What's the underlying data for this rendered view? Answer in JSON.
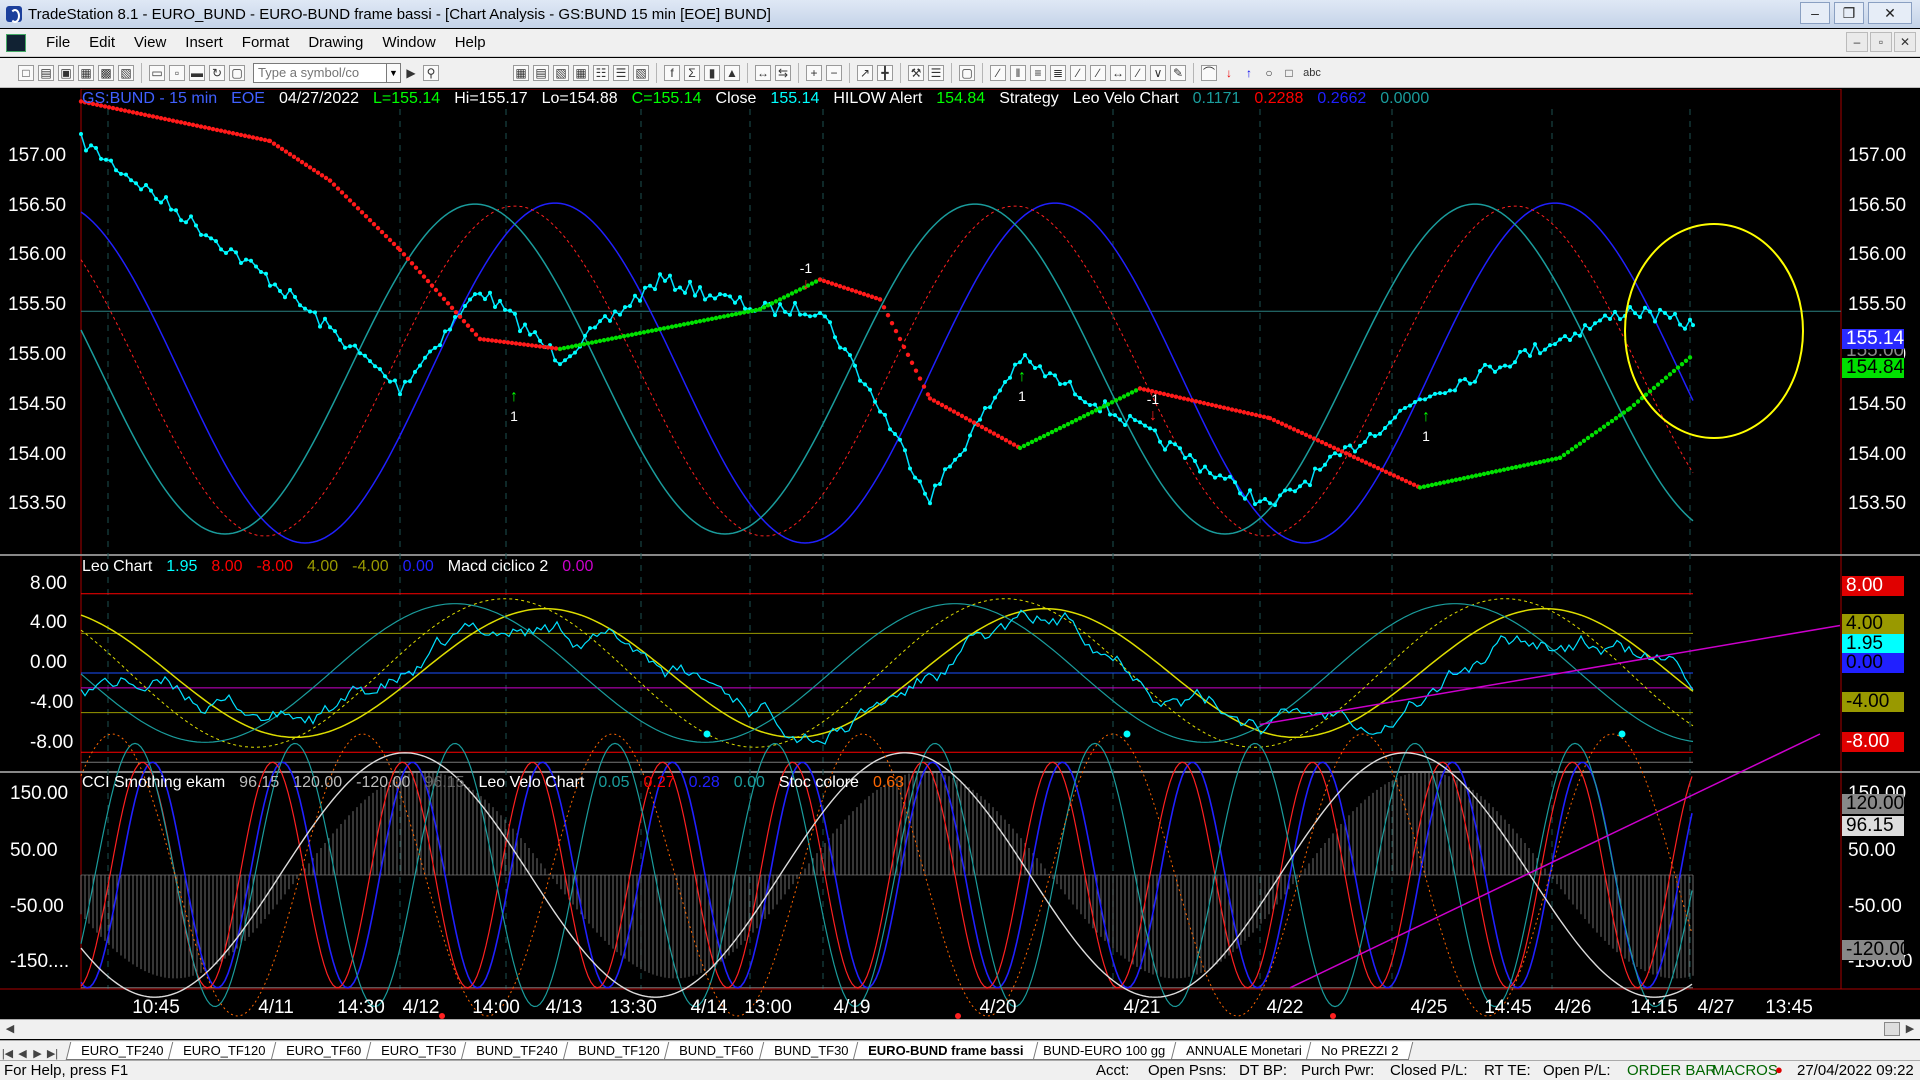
{
  "window": {
    "title": "TradeStation 8.1 - EURO_BUND - EURO-BUND frame bassi - [Chart Analysis - GS:BUND  15 min  [EOE] BUND]"
  },
  "menu": [
    "File",
    "Edit",
    "View",
    "Insert",
    "Format",
    "Drawing",
    "Window",
    "Help"
  ],
  "toolbar": {
    "symbol_placeholder": "Type a symbol/co",
    "text_tool": "abc"
  },
  "colors": {
    "background": "#000000",
    "price_line": "#00ffff",
    "up_trend": "#00dd00",
    "down_trend": "#ff0000",
    "cycle_blue": "#2020ff",
    "cycle_teal": "#1a9c9c",
    "accent_yellow": "#ffff00",
    "magenta": "#cc00cc"
  },
  "panes": {
    "price": {
      "legend": [
        {
          "text": "GS:BUND - 15 min",
          "color": "#4060ff"
        },
        {
          "text": "EOE",
          "color": "#4060ff"
        },
        {
          "text": "04/27/2022",
          "color": "#ffffff"
        },
        {
          "text": "L=155.14",
          "color": "#00ff00"
        },
        {
          "text": "Hi=155.17",
          "color": "#ffffff"
        },
        {
          "text": "Lo=154.88",
          "color": "#ffffff"
        },
        {
          "text": "C=155.14",
          "color": "#00ff00"
        },
        {
          "text": "Close",
          "color": "#ffffff"
        },
        {
          "text": "155.14",
          "color": "#00ffff"
        },
        {
          "text": "HILOW Alert",
          "color": "#ffffff"
        },
        {
          "text": "154.84",
          "color": "#00ff00"
        },
        {
          "text": "Strategy",
          "color": "#ffffff"
        },
        {
          "text": "Leo Velo Chart",
          "color": "#ffffff"
        },
        {
          "text": "0.1171",
          "color": "#1a9c9c"
        },
        {
          "text": "0.2288",
          "color": "#ff0000"
        },
        {
          "text": "0.2662",
          "color": "#2020ff"
        },
        {
          "text": "0.0000",
          "color": "#1a9c9c"
        }
      ],
      "y_ticks": [
        "157.00",
        "156.50",
        "156.00",
        "155.50",
        "155.00",
        "154.50",
        "154.00",
        "153.50"
      ],
      "tag_last": "155.14",
      "tag_alert": "154.84",
      "tag_hidden": "155.00",
      "trade_markers": [
        "1",
        "-1",
        "1",
        "-1",
        "1"
      ]
    },
    "leo": {
      "legend": [
        {
          "text": "Leo Chart",
          "color": "#ffffff"
        },
        {
          "text": "1.95",
          "color": "#00ffff"
        },
        {
          "text": "8.00",
          "color": "#ff0000"
        },
        {
          "text": "-8.00",
          "color": "#ff0000"
        },
        {
          "text": "4.00",
          "color": "#999900"
        },
        {
          "text": "-4.00",
          "color": "#999900"
        },
        {
          "text": "0.00",
          "color": "#2020ff"
        },
        {
          "text": "Macd ciclico 2",
          "color": "#ffffff"
        },
        {
          "text": "0.00",
          "color": "#cc00cc"
        }
      ],
      "y_ticks": [
        "8.00",
        "4.00",
        "0.00",
        "-4.00",
        "-8.00"
      ],
      "tags": [
        "8.00",
        "4.00",
        "1.95",
        "0.00",
        "-4.00",
        "-8.00"
      ]
    },
    "cci": {
      "legend": [
        {
          "text": "CCI Smothing ekam",
          "color": "#ffffff"
        },
        {
          "text": "96.15",
          "color": "#bbbbbb"
        },
        {
          "text": "120.00",
          "color": "#bbbbbb"
        },
        {
          "text": "-120.00",
          "color": "#bbbbbb"
        },
        {
          "text": "96.15",
          "color": "#666666"
        },
        {
          "text": "Leo Velo Chart",
          "color": "#ffffff"
        },
        {
          "text": "0.05",
          "color": "#1a9c9c"
        },
        {
          "text": "0.27",
          "color": "#ff0000"
        },
        {
          "text": "0.28",
          "color": "#2020ff"
        },
        {
          "text": "0.00",
          "color": "#1a9c9c"
        },
        {
          "text": "Stoc colore",
          "color": "#ffffff"
        },
        {
          "text": "0.63",
          "color": "#ff6600"
        }
      ],
      "y_ticks": [
        "150.00",
        "50.00",
        "-50.00",
        "-150...."
      ],
      "tags": [
        "150.00",
        "120.00",
        "96.15",
        "50.00",
        "-50.00",
        "-120.00",
        "-150.00"
      ]
    }
  },
  "x_axis": [
    "10:45",
    "4/11",
    "14:30",
    "4/12",
    "14:00",
    "4/13",
    "13:30",
    "4/14",
    "13:00",
    "4/19",
    "4/20",
    "4/21",
    "4/22",
    "4/25",
    "14:45",
    "4/26",
    "14:15",
    "4/27",
    "13:45"
  ],
  "tabs": [
    "EURO_TF240",
    "EURO_TF120",
    "EURO_TF60",
    "EURO_TF30",
    "BUND_TF240",
    "BUND_TF120",
    "BUND_TF60",
    "BUND_TF30",
    "EURO-BUND frame bassi",
    "BUND-EURO 100 gg",
    "ANNUALE Monetari",
    "No PREZZI 2"
  ],
  "active_tab": "EURO-BUND frame bassi",
  "status": {
    "help": "For Help, press F1",
    "acct": "Acct:",
    "open_psns": "Open Psns:",
    "dt_bp": "DT BP:",
    "purch_pwr": "Purch Pwr:",
    "closed_pl": "Closed P/L:",
    "rt_te": "RT TE:",
    "open_pl": "Open P/L:",
    "order_bar": "ORDER BAR",
    "macros": "MACROS",
    "datetime": "27/04/2022 09:22"
  },
  "chart_data": {
    "type": "line",
    "title": "GS:BUND - 15 min",
    "x_categories": [
      "10:45",
      "4/11",
      "14:30",
      "4/12",
      "14:00",
      "4/13",
      "13:30",
      "4/14",
      "13:00",
      "4/19",
      "4/20",
      "4/21",
      "4/22",
      "4/25",
      "14:45",
      "4/26",
      "14:15",
      "4/27"
    ],
    "ylim": [
      153.0,
      157.5
    ],
    "series": [
      {
        "name": "Close",
        "values": [
          157.0,
          155.6,
          155.1,
          154.5,
          155.5,
          154.8,
          155.6,
          155.3,
          155.3,
          154.3,
          153.4,
          154.8,
          154.1,
          153.3,
          154.4,
          155.0,
          155.3,
          155.14
        ]
      },
      {
        "name": "HILOW Alert",
        "values": [
          157.4,
          157.0,
          156.6,
          155.9,
          155.0,
          154.9,
          155.1,
          155.3,
          155.6,
          155.4,
          154.4,
          153.9,
          154.5,
          154.2,
          153.5,
          153.8,
          154.3,
          154.84
        ]
      }
    ]
  }
}
